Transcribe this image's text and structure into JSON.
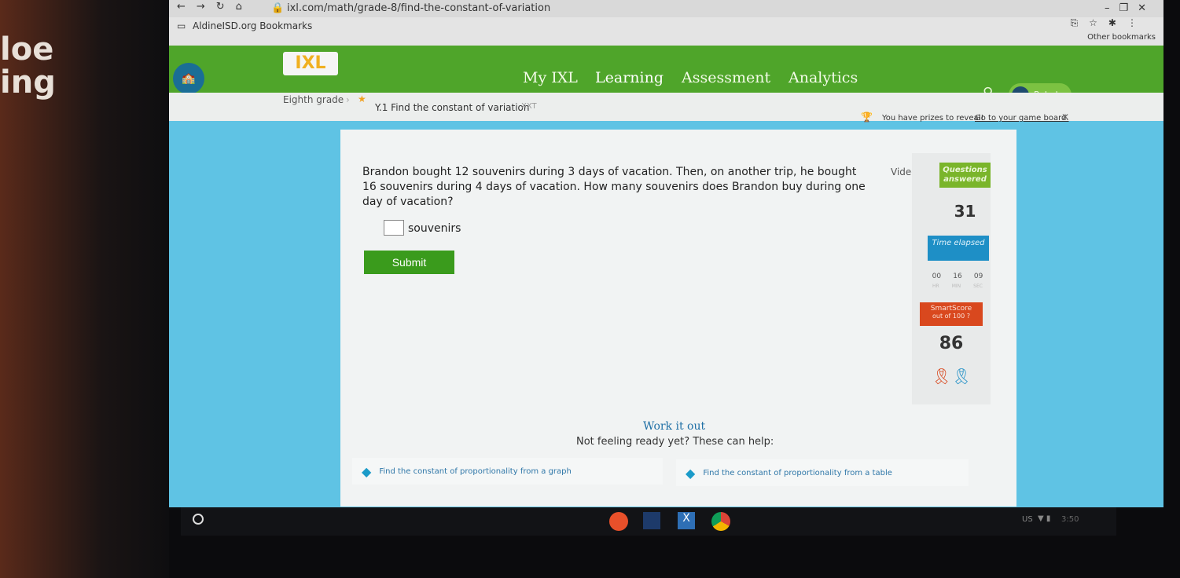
{
  "background_text": [
    "loe",
    "ing"
  ],
  "browser": {
    "url": "ixl.com/math/grade-8/find-the-constant-of-variation",
    "bookmark": "AldineISD.org Bookmarks",
    "other_bookmarks": "Other bookmarks"
  },
  "nav": {
    "logo": "IXL",
    "links": [
      "My IXL",
      "Learning",
      "Assessment",
      "Analytics"
    ],
    "active": "Learning",
    "user": "Rebeka"
  },
  "breadcrumb": {
    "grade": "Eighth grade",
    "skill": "Y.1 Find the constant of variation",
    "code": "XXT"
  },
  "banner": {
    "text": "You have prizes to reveal!",
    "link": "Go to your game board."
  },
  "question": {
    "text": "Brandon bought 12 souvenirs during 3 days of vacation. Then, on another trip, he bought 16 souvenirs during 4 days of vacation. How many souvenirs does Brandon buy during one day of vacation?",
    "unit": "souvenirs",
    "input_value": "",
    "submit": "Submit"
  },
  "stats": {
    "video": "Video",
    "questions_label": "Questions answered",
    "questions": "31",
    "time_label": "Time elapsed",
    "hr": "00",
    "min": "16",
    "sec": "09",
    "hr_l": "HR",
    "min_l": "MIN",
    "sec_l": "SEC",
    "smartscore_label": "SmartScore",
    "smartscore_sub": "out of 100",
    "smartscore": "86"
  },
  "help": {
    "title": "Work it out",
    "subtitle": "Not feeling ready yet? These can help:",
    "links": [
      "Find the constant of proportionality from a graph",
      "Find the constant of proportionality from a table"
    ]
  },
  "taskbar": {
    "locale": "US",
    "time": "3:50"
  },
  "colors": {
    "green": "#4fa52a",
    "blue": "#1e8fc6",
    "orange": "#d9481e",
    "qgreen": "#7ab52b"
  }
}
